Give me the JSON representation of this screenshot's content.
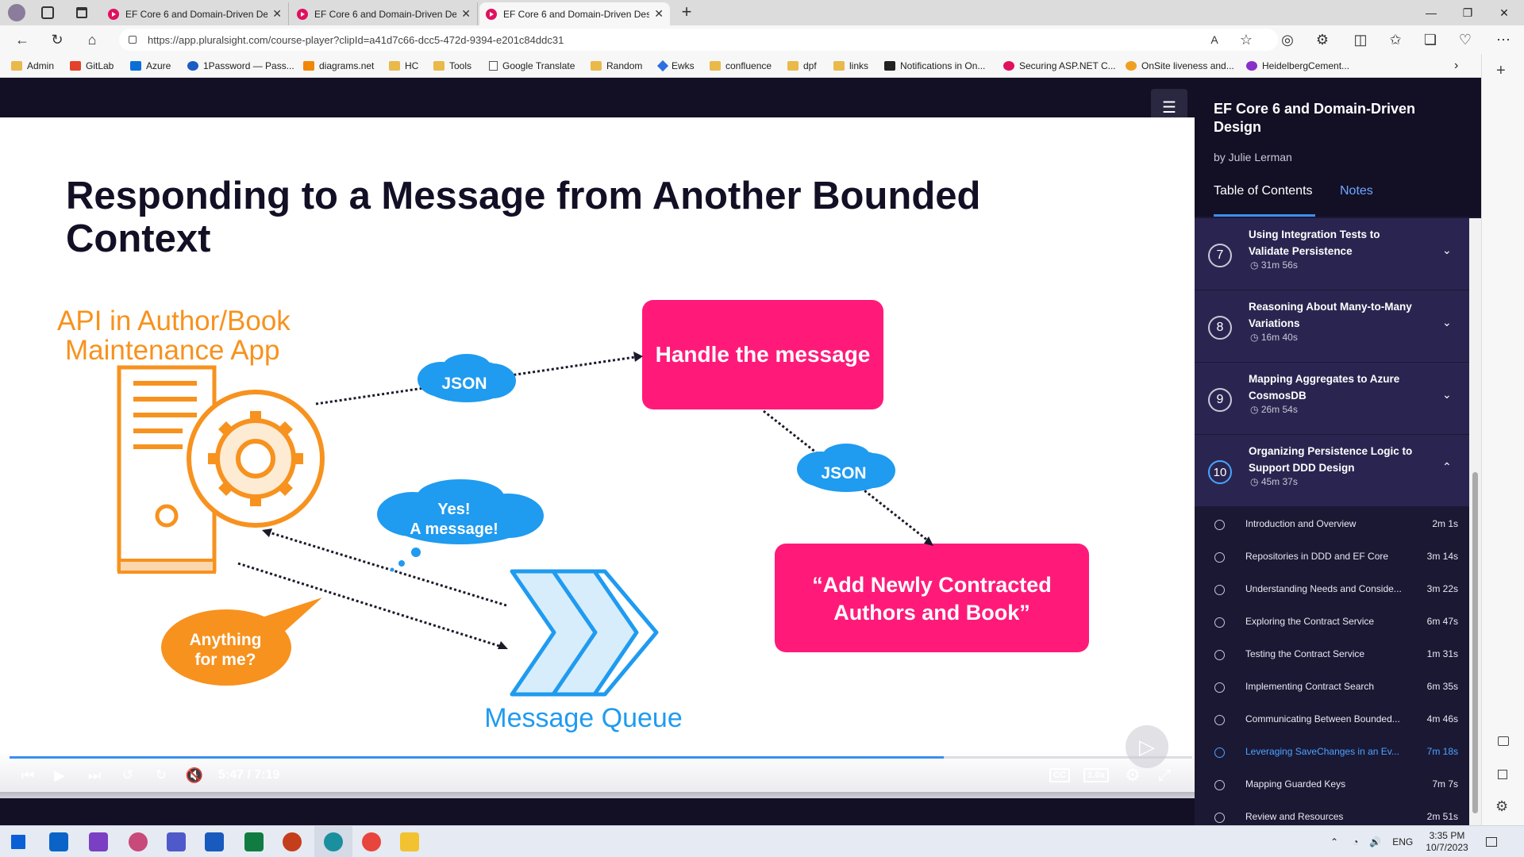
{
  "browser": {
    "tabs": [
      {
        "label": "EF Core 6 and Domain-Driven Design",
        "active": false
      },
      {
        "label": "EF Core 6 and Domain-Driven Design",
        "active": false
      },
      {
        "label": "EF Core 6 and Domain-Driven Design",
        "active": true
      }
    ],
    "url": "https://app.pluralsight.com/course-player?clipId=a41d7c66-dcc5-472d-9394-e201c84ddc31",
    "bookmarks": [
      "Admin",
      "GitLab",
      "Azure",
      "1Password — Pass...",
      "diagrams.net",
      "HC",
      "Tools",
      "Google Translate",
      "Random",
      "Ewks",
      "confluence",
      "dpf",
      "links",
      "Notifications in On...",
      "Securing ASP.NET C...",
      "OnSite liveness and...",
      "HeidelbergCement..."
    ]
  },
  "slide": {
    "title": "Responding to a Message from Another Bounded Context",
    "api_label_1": "API in Author/Book",
    "api_label_2": "Maintenance App",
    "handle_label": "Handle the message",
    "json_1": "JSON",
    "json_2": "JSON",
    "yes_1": "Yes!",
    "yes_2": "A message!",
    "anything_1": "Anything",
    "anything_2": "for me?",
    "contract_1": "“Add Newly Contracted",
    "contract_2": "Authors and Book”",
    "queue_label": "Message Queue"
  },
  "player": {
    "time_current": "5:47",
    "time_total": "7:19",
    "time_sep": " / ",
    "progress": 0.79,
    "speed": "1.0x",
    "cc": "CC"
  },
  "course": {
    "title": "EF Core 6 and Domain-Driven Design",
    "author": "by Julie Lerman",
    "tab_toc": "Table of Contents",
    "tab_notes": "Notes",
    "modules": [
      {
        "num": "7",
        "title": "Using Integration Tests to Validate Persistence",
        "duration": "31m 56s",
        "expanded": false
      },
      {
        "num": "8",
        "title": "Reasoning About Many-to-Many Variations",
        "duration": "16m 40s",
        "expanded": false
      },
      {
        "num": "9",
        "title": "Mapping Aggregates to Azure CosmosDB",
        "duration": "26m 54s",
        "expanded": false
      },
      {
        "num": "10",
        "title": "Organizing Persistence Logic to Support DDD Design",
        "duration": "45m 37s",
        "expanded": true
      }
    ],
    "clips": [
      {
        "title": "Introduction and Overview",
        "duration": "2m 1s"
      },
      {
        "title": "Repositories in DDD and EF Core",
        "duration": "3m 14s"
      },
      {
        "title": "Understanding Needs and Conside...",
        "duration": "3m 22s"
      },
      {
        "title": "Exploring the Contract Service",
        "duration": "6m 47s"
      },
      {
        "title": "Testing the Contract Service",
        "duration": "1m 31s"
      },
      {
        "title": "Implementing Contract Search",
        "duration": "6m 35s"
      },
      {
        "title": "Communicating Between Bounded...",
        "duration": "4m 46s"
      },
      {
        "title": "Leveraging SaveChanges in an Ev...",
        "duration": "7m 18s",
        "current": true
      },
      {
        "title": "Mapping Guarded Keys",
        "duration": "7m 7s"
      },
      {
        "title": "Review and Resources",
        "duration": "2m 51s"
      }
    ]
  },
  "taskbar": {
    "lang": "ENG",
    "time": "3:35 PM",
    "date": "10/7/2023"
  },
  "colors": {
    "accent": "#3a8ff0",
    "pink": "#ff1a7a",
    "orange": "#f7921e",
    "navy": "#130f25",
    "sidebar": "#1b1834"
  }
}
